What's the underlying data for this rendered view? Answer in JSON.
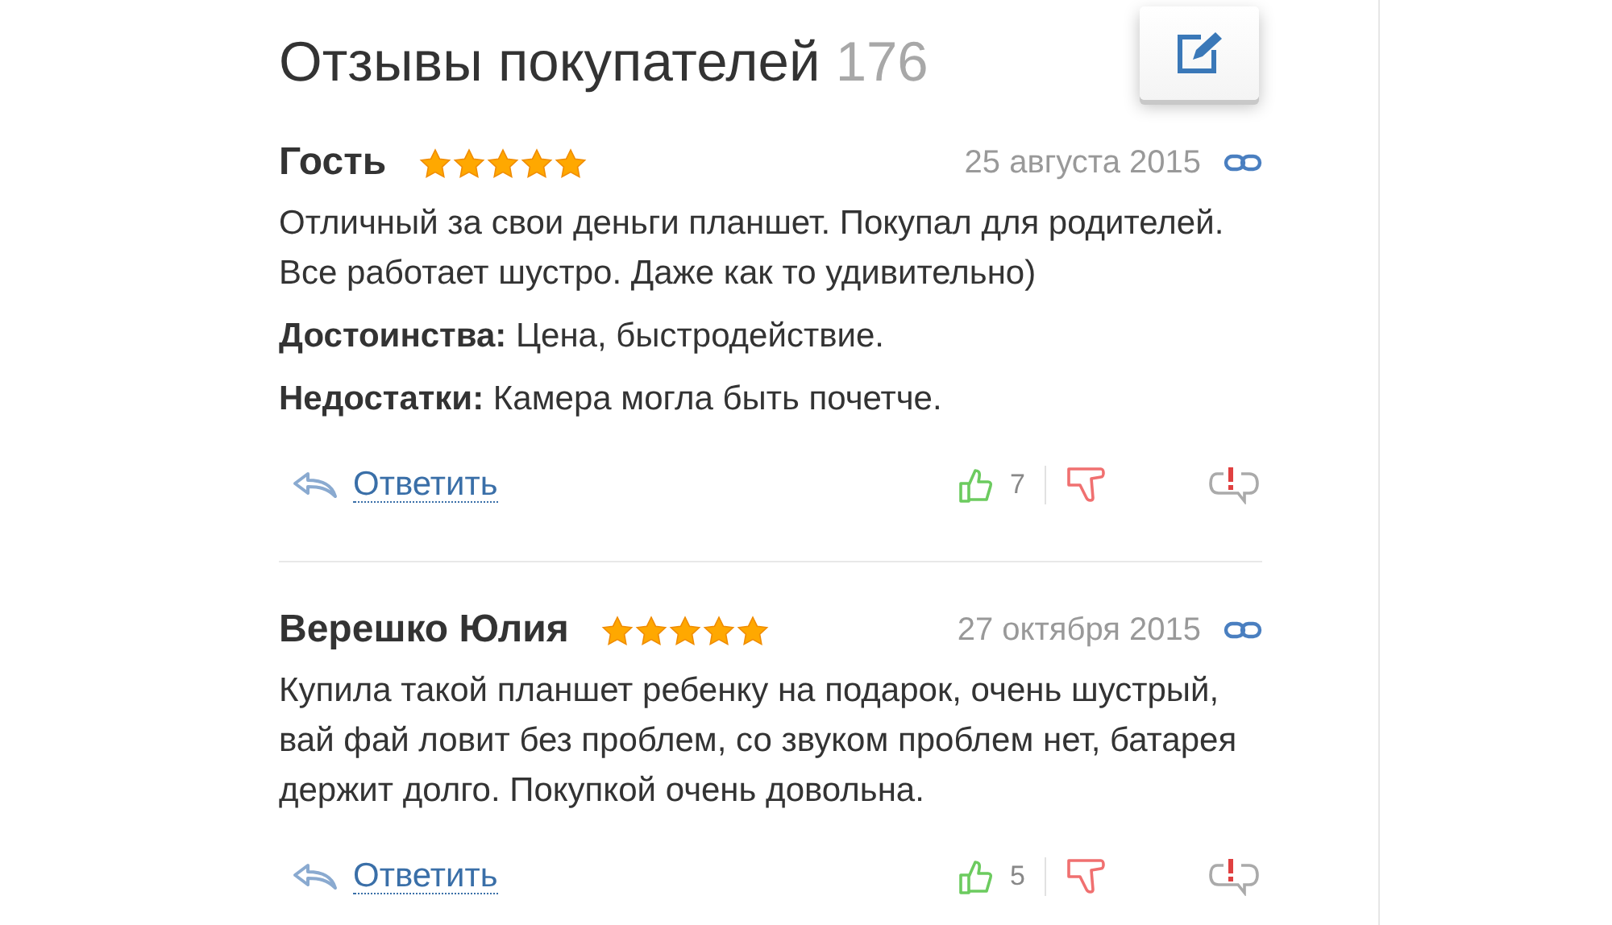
{
  "header": {
    "title": "Отзывы покупателей",
    "count": "176"
  },
  "reviews": [
    {
      "author": "Гость",
      "stars": 5,
      "date": "25 августа 2015",
      "paragraphs": [
        "Отличный за свои деньги планшет. Покупал для родителей. Все работает шустро. Даже как то удивительно)",
        "**Достоинства:** Цена, быстродействие.",
        "**Недостатки:** Камера могла быть почетче."
      ],
      "reply": "Ответить",
      "likes": "7"
    },
    {
      "author": "Верешко Юлия",
      "stars": 5,
      "date": "27 октября 2015",
      "paragraphs": [
        "Купила такой планшет ребенку на подарок, очень шустрый, вай фай ловит без проблем, со звуком проблем нет, батарея держит долго. Покупкой очень довольна."
      ],
      "reply": "Ответить",
      "likes": "5"
    }
  ]
}
